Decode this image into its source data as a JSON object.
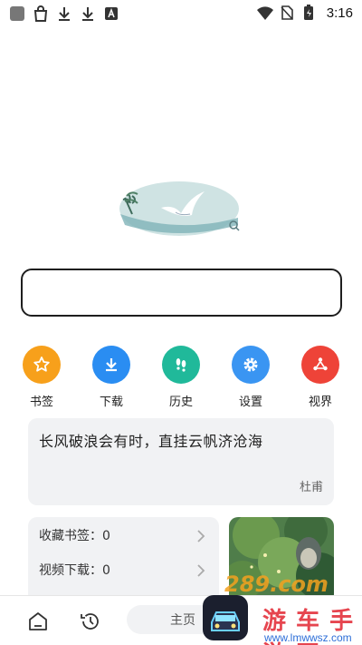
{
  "status_bar": {
    "time": "3:16",
    "left_icons": [
      "app-square-icon",
      "bag-icon",
      "download-icon",
      "download-icon",
      "text-app-icon"
    ],
    "right_icons": [
      "wifi-icon",
      "no-sim-icon",
      "battery-charging-icon"
    ]
  },
  "search": {
    "placeholder": ""
  },
  "shortcuts": [
    {
      "label": "书签",
      "icon": "star-icon",
      "color": "#f7a01b"
    },
    {
      "label": "下载",
      "icon": "download-icon",
      "color": "#2a8df2"
    },
    {
      "label": "历史",
      "icon": "footprints-icon",
      "color": "#20b99a"
    },
    {
      "label": "设置",
      "icon": "gear-icon",
      "color": "#3a95f2"
    },
    {
      "label": "视界",
      "icon": "vision-icon",
      "color": "#ee4338"
    }
  ],
  "quote": {
    "text": "长风破浪会有时，直挂云帆济沧海",
    "author": "杜甫"
  },
  "stats": [
    {
      "label": "收藏书签：0"
    },
    {
      "label": "视频下载：0"
    }
  ],
  "bottom_nav": {
    "home_label": "主页"
  },
  "watermark": {
    "top": "289.com",
    "middle": "游 车 手 游 网",
    "url": "www.lmwwsz.com"
  },
  "colors": {
    "accent": "#2a8df2",
    "card_bg": "#f1f2f4"
  }
}
